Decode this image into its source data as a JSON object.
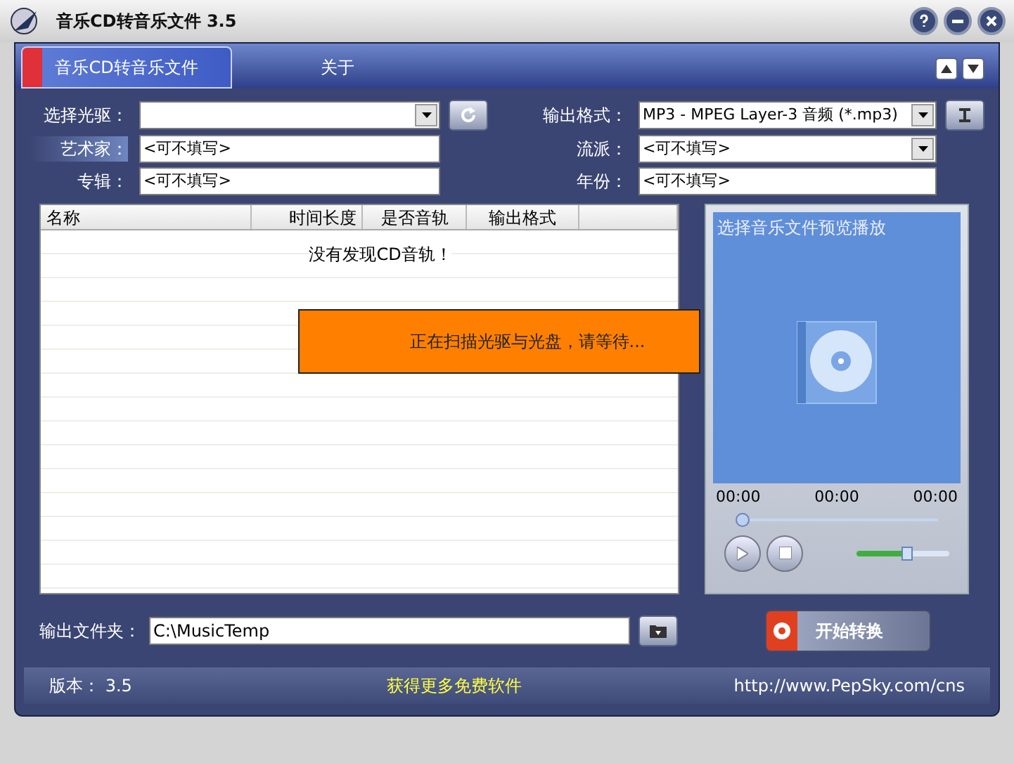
{
  "window": {
    "title": "音乐CD转音乐文件 3.5"
  },
  "tabs": [
    {
      "label": "音乐CD转音乐文件",
      "selected": true
    },
    {
      "label": "关于",
      "selected": false
    }
  ],
  "form": {
    "left": [
      {
        "label": "选择光驱：",
        "kind": "dropdown",
        "highlighted": false
      },
      {
        "label": "艺术家：",
        "value": "<可不填写>",
        "kind": "text",
        "highlighted": true
      },
      {
        "label": "专辑：",
        "value": "<可不填写>",
        "kind": "text",
        "highlighted": false
      }
    ],
    "right": [
      {
        "label": "输出格式：",
        "value": "MP3 - MPEG Layer-3 音频 (*.mp3)",
        "kind": "dropdown",
        "highlighted": false
      },
      {
        "label": "流派：",
        "value": "<可不填写>",
        "kind": "dropdown",
        "highlighted": false
      },
      {
        "label": "年份：",
        "value": "<可不填写>",
        "kind": "text",
        "highlighted": false
      }
    ]
  },
  "table": {
    "columns": [
      "名称",
      "时间长度",
      "是否音轨",
      "输出格式"
    ],
    "empty_message": "没有发现CD音轨！"
  },
  "overlay": {
    "message": "正在扫描光驱与光盘，请等待..."
  },
  "preview": {
    "title": "选择音乐文件预览播放",
    "times": [
      "00:00",
      "00:00",
      "00:00"
    ],
    "position": {
      "level": 0
    },
    "volume": {
      "level": 0.55
    }
  },
  "output_folder": {
    "label": "输出文件夹：",
    "value": "C:\\MusicTemp"
  },
  "start_button": {
    "label": "开始转换"
  },
  "status_bar": {
    "version": "版本： 3.5",
    "link": "获得更多免费软件",
    "url": "http://www.PepSky.com/cns"
  }
}
